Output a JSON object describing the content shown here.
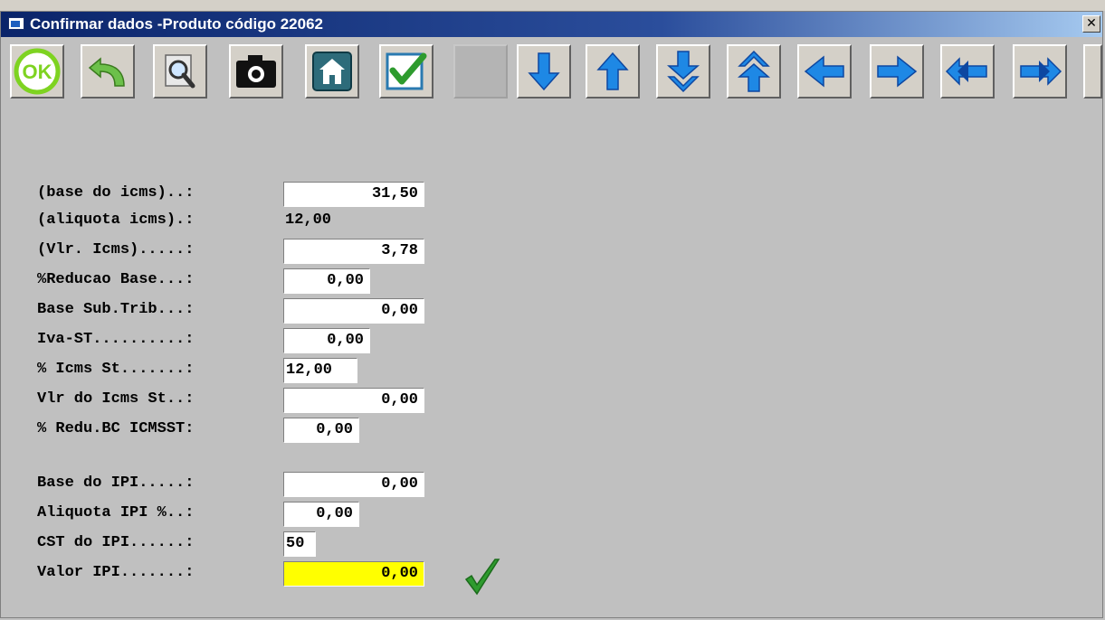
{
  "window": {
    "title": "Confirmar dados -Produto código 22062",
    "close_label": "✕"
  },
  "toolbar": {
    "buttons": [
      {
        "name": "ok",
        "icon": "ok-icon"
      },
      {
        "name": "undo",
        "icon": "undo-arrow-icon"
      },
      {
        "name": "search",
        "icon": "magnifier-icon"
      },
      {
        "name": "camera",
        "icon": "camera-icon"
      },
      {
        "name": "home",
        "icon": "home-icon"
      },
      {
        "name": "confirm",
        "icon": "checkbox-checked-icon"
      },
      {
        "name": "blank",
        "icon": "",
        "disabled": true
      },
      {
        "name": "down",
        "icon": "arrow-down-icon"
      },
      {
        "name": "up",
        "icon": "arrow-up-icon"
      },
      {
        "name": "last",
        "icon": "arrow-down-double-icon"
      },
      {
        "name": "first",
        "icon": "arrow-up-double-icon"
      },
      {
        "name": "left",
        "icon": "arrow-left-icon"
      },
      {
        "name": "right",
        "icon": "arrow-right-icon"
      },
      {
        "name": "left-double",
        "icon": "arrow-left-double-icon"
      },
      {
        "name": "right-double",
        "icon": "arrow-right-double-icon"
      }
    ]
  },
  "form": {
    "base_icms": {
      "label": "(base do icms)..:",
      "value": "31,50"
    },
    "aliquota_icms": {
      "label": "(aliquota icms).:",
      "value": "12,00"
    },
    "vlr_icms": {
      "label": "(Vlr. Icms).....:",
      "value": "3,78"
    },
    "reducao_base": {
      "label": "%Reducao Base...:",
      "value": "0,00"
    },
    "base_sub_trib": {
      "label": "Base Sub.Trib...:",
      "value": "0,00"
    },
    "iva_st": {
      "label": "Iva-ST..........:",
      "value": "0,00"
    },
    "icms_st_pct": {
      "label": "% Icms St.......:",
      "value": "12,00"
    },
    "vlr_icms_st": {
      "label": "Vlr do Icms St..:",
      "value": "0,00"
    },
    "redu_bc_icmsst": {
      "label": "% Redu.BC ICMSST:",
      "value": "0,00"
    },
    "base_ipi": {
      "label": "Base do IPI.....:",
      "value": "0,00"
    },
    "aliquota_ipi": {
      "label": "Aliquota IPI %..:",
      "value": "0,00"
    },
    "cst_ipi": {
      "label": "CST do IPI......:",
      "value": "50"
    },
    "valor_ipi": {
      "label": "Valor IPI.......:",
      "value": "0,00"
    }
  },
  "colors": {
    "background": "#c0c0c0",
    "highlight_field": "#ffff00",
    "arrow_blue": "#1e88e5",
    "ok_green": "#7ed321"
  }
}
